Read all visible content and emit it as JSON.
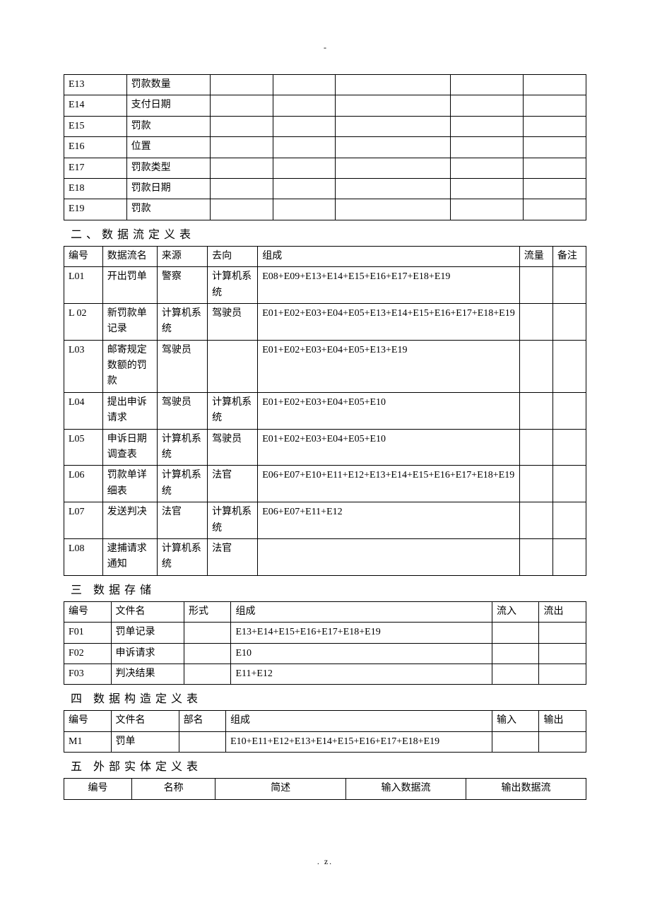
{
  "topdot": "-",
  "table1": {
    "rows": [
      {
        "c1": "E13",
        "c2": "罚款数量"
      },
      {
        "c1": "E14",
        "c2": "支付日期"
      },
      {
        "c1": "E15",
        "c2": "罚款"
      },
      {
        "c1": "E16",
        "c2": "位置"
      },
      {
        "c1": "E17",
        "c2": "罚款类型"
      },
      {
        "c1": "E18",
        "c2": "罚款日期"
      },
      {
        "c1": "E19",
        "c2": "罚款"
      }
    ]
  },
  "heading2": "二、数据流定义表",
  "table2": {
    "headers": [
      "编号",
      "数据流名",
      "来源",
      "去向",
      "组成",
      "流量",
      "备注"
    ],
    "rows": [
      {
        "c1": "L01",
        "c2": "开出罚单",
        "c3": "警察",
        "c4": "计算机系统",
        "c5": "E08+E09+E13+E14+E15+E16+E17+E18+E19",
        "c6": "",
        "c7": ""
      },
      {
        "c1": "L 02",
        "c2": "新罚款单记录",
        "c3": "计算机系统",
        "c4": "驾驶员",
        "c5": "E01+E02+E03+E04+E05+E13+E14+E15+E16+E17+E18+E19",
        "c6": "",
        "c7": ""
      },
      {
        "c1": "L03",
        "c2": "邮寄规定数额的罚款",
        "c3": "驾驶员",
        "c4": "",
        "c5": "E01+E02+E03+E04+E05+E13+E19",
        "c6": "",
        "c7": ""
      },
      {
        "c1": "L04",
        "c2": "提出申诉请求",
        "c3": "驾驶员",
        "c4": "计算机系统",
        "c5": "E01+E02+E03+E04+E05+E10",
        "c6": "",
        "c7": ""
      },
      {
        "c1": "L05",
        "c2": "申诉日期调查表",
        "c3": "计算机系统",
        "c4": "驾驶员",
        "c5": "E01+E02+E03+E04+E05+E10",
        "c6": "",
        "c7": ""
      },
      {
        "c1": "L06",
        "c2": "罚款单详细表",
        "c3": "计算机系统",
        "c4": "法官",
        "c5": "E06+E07+E10+E11+E12+E13+E14+E15+E16+E17+E18+E19",
        "c6": "",
        "c7": ""
      },
      {
        "c1": "L07",
        "c2": "发送判决",
        "c3": "法官",
        "c4": "计算机系统",
        "c5": "E06+E07+E11+E12",
        "c6": "",
        "c7": ""
      },
      {
        "c1": "L08",
        "c2": "逮捕请求通知",
        "c3": "计算机系统",
        "c4": "法官",
        "c5": "",
        "c6": "",
        "c7": ""
      }
    ]
  },
  "heading3": "三 数据存储",
  "table3": {
    "headers": [
      "编号",
      "文件名",
      "形式",
      "组成",
      "流入",
      "流出"
    ],
    "rows": [
      {
        "c1": "F01",
        "c2": "罚单记录",
        "c3": "",
        "c4": "E13+E14+E15+E16+E17+E18+E19",
        "c5": "",
        "c6": ""
      },
      {
        "c1": "F02",
        "c2": "申诉请求",
        "c3": "",
        "c4": "E10",
        "c5": "",
        "c6": ""
      },
      {
        "c1": "F03",
        "c2": "判决结果",
        "c3": "",
        "c4": "E11+E12",
        "c5": "",
        "c6": ""
      }
    ]
  },
  "heading4": "四 数据构造定义表",
  "table4": {
    "headers": [
      "编号",
      "文件名",
      "部名",
      "组成",
      "输入",
      "输出"
    ],
    "rows": [
      {
        "c1": "M1",
        "c2": "罚单",
        "c3": "",
        "c4": "E10+E11+E12+E13+E14+E15+E16+E17+E18+E19",
        "c5": "",
        "c6": ""
      }
    ]
  },
  "heading5": "五 外部实体定义表",
  "table5": {
    "headers": [
      "编号",
      "名称",
      "简述",
      "输入数据流",
      "输出数据流"
    ]
  },
  "footer": ".          z."
}
